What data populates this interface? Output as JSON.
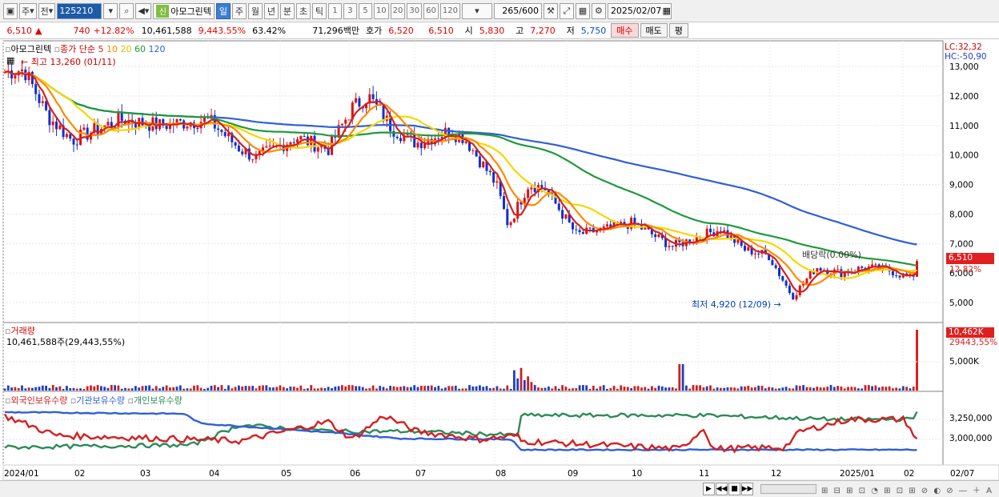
{
  "toolbar": {
    "market": "주",
    "period_mode": "전",
    "code": "125210",
    "flag": "신",
    "name": "아모그린텍",
    "periods": [
      "일",
      "주",
      "월",
      "년",
      "분",
      "초",
      "틱"
    ],
    "active_period": "일",
    "intervals": [
      "1",
      "3",
      "5",
      "10",
      "20",
      "30",
      "60",
      "120"
    ],
    "count": "265",
    "count_max": "/600",
    "date": "2025/02/07"
  },
  "quote": {
    "price": "6,510",
    "change_arrow": "▲",
    "change": "740",
    "change_pct": "+12.82%",
    "volume": "10,461,588",
    "volume_pct": "9,443.55%",
    "turnover": "63.42%",
    "amount": "71,296백만",
    "ask_label": "호가",
    "ask": "6,520",
    "bid": "6,510",
    "open_label": "시",
    "open": "5,830",
    "high_label": "고",
    "high": "7,270",
    "low_label": "저",
    "low": "5,750",
    "buy": "매수",
    "sell": "매도",
    "eval": "평"
  },
  "price_panel": {
    "stock": "아모그린텍",
    "ma_label": "종가 단순",
    "ma_periods": [
      "5",
      "10",
      "20",
      "60",
      "120"
    ],
    "ma_colors": [
      "#d42020",
      "#ff8a00",
      "#f5d800",
      "#1f9a3a",
      "#2f5fd8"
    ],
    "high_note": "최고 13,260 (01/11)",
    "low_note": "최저 4,920 (12/09)",
    "dividend_note": "배당락(0.00%)",
    "lc": "LC:32,32",
    "hc": "HC:-50,90",
    "price_tag": "6,510",
    "pct_tag": "12.82%",
    "y_labels": [
      "13,000",
      "12,000",
      "11,000",
      "10,000",
      "9,000",
      "8,000",
      "7,000",
      "6,000",
      "5,000"
    ]
  },
  "volume_panel": {
    "title": "거래량",
    "value_text": "10,461,588주(29,443,55%)",
    "tag": "10,462K",
    "pct": "29443,55%",
    "y_label": "5,000K"
  },
  "holding_panel": {
    "legend": [
      "외국인보유수량",
      "기관보유수량",
      "개인보유수량"
    ],
    "colors": [
      "#d42020",
      "#2f5fd8",
      "#2e8a5a"
    ],
    "y_labels": [
      "3,250,000",
      "3,000,000"
    ]
  },
  "x_labels": [
    "2024/01",
    "02",
    "03",
    "04",
    "05",
    "06",
    "07",
    "08",
    "09",
    "10",
    "11",
    "12",
    "2025/01",
    "02",
    "02/07"
  ]
}
